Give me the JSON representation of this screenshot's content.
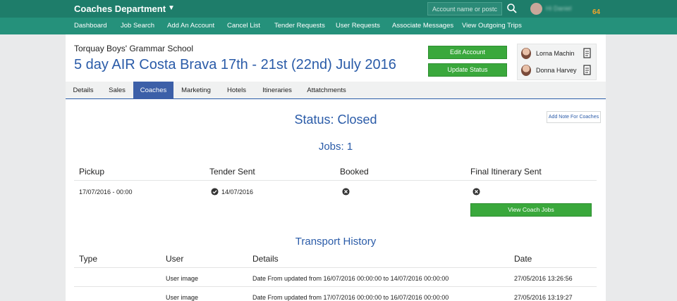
{
  "header": {
    "brand": "Coaches Department",
    "search_placeholder": "Account name or postcode",
    "user_name": "Hi Daniel",
    "notification_count": "64"
  },
  "nav": [
    "Dashboard",
    "Job Search",
    "Add An Account",
    "Cancel List",
    "Tender Requests",
    "User Requests",
    "Associate Messages",
    "View Outgoing Trips"
  ],
  "account": {
    "school": "Torquay Boys' Grammar School",
    "trip_title": "5 day AIR Costa Brava 17th - 21st (22nd) July 2016",
    "edit_button": "Edit Account",
    "update_button": "Update Status",
    "staff": [
      "Lorna Machin",
      "Donna Harvey"
    ]
  },
  "tabs": [
    "Details",
    "Sales",
    "Coaches",
    "Marketing",
    "Hotels",
    "Itineraries",
    "Attatchments"
  ],
  "active_tab": "Coaches",
  "content": {
    "status": "Status: Closed",
    "note_button": "Add Note For Coaches",
    "jobs_heading": "Jobs: 1",
    "jobs_columns": [
      "Pickup",
      "Tender Sent",
      "Booked",
      "Final Itinerary Sent"
    ],
    "jobs_rows": [
      {
        "pickup": "17/07/2016 - 00:00",
        "tender_sent": "14/07/2016",
        "booked": "x-icon",
        "final_itinerary": "x-icon"
      }
    ],
    "view_jobs_button": "View Coach Jobs",
    "history_heading": "Transport History",
    "history_columns": [
      "Type",
      "User",
      "Details",
      "Date"
    ],
    "history_rows": [
      {
        "type": "",
        "user": "User image",
        "details": "Date From updated from 16/07/2016 00:00:00 to 14/07/2016 00:00:00",
        "date": "27/05/2016 13:26:56"
      },
      {
        "type": "",
        "user": "User image",
        "details": "Date From updated from 17/07/2016 00:00:00 to 16/07/2016 00:00:00",
        "date": "27/05/2016 13:19:27"
      }
    ]
  },
  "colors": {
    "topbar": "#1e7d6a",
    "navbar": "#25917b",
    "accent": "#2a5ba8",
    "button": "#3aa83c",
    "badge": "#f4a52a"
  }
}
